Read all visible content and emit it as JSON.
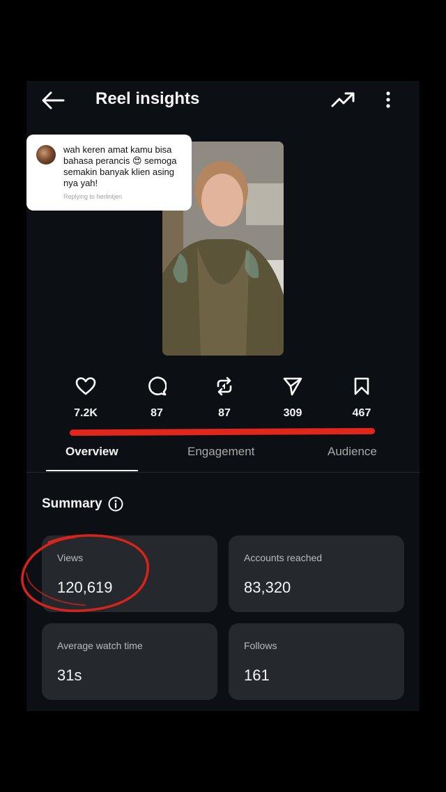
{
  "header": {
    "title": "Reel insights",
    "back_icon": "arrow-left-icon",
    "trend_icon": "trending-up-icon",
    "more_icon": "more-vertical-icon"
  },
  "comment": {
    "text": "wah keren amat kamu bisa bahasa perancis 😍 semoga semakin banyak klien asing nya yah!",
    "reply_note": "Replying to herlintjen"
  },
  "stats": [
    {
      "icon": "heart-icon",
      "value": "7.2K"
    },
    {
      "icon": "comment-icon",
      "value": "87"
    },
    {
      "icon": "repost-icon",
      "value": "87"
    },
    {
      "icon": "share-icon",
      "value": "309"
    },
    {
      "icon": "bookmark-icon",
      "value": "467"
    }
  ],
  "tabs": [
    {
      "label": "Overview",
      "active": true
    },
    {
      "label": "Engagement",
      "active": false
    },
    {
      "label": "Audience",
      "active": false
    }
  ],
  "summary": {
    "title": "Summary",
    "cards": [
      {
        "label": "Views",
        "value": "120,619"
      },
      {
        "label": "Accounts reached",
        "value": "83,320"
      },
      {
        "label": "Average watch time",
        "value": "31s"
      },
      {
        "label": "Follows",
        "value": "161"
      }
    ]
  },
  "colors": {
    "background": "#0c1014",
    "card": "#25292e",
    "annotation_red": "#e3261b"
  }
}
